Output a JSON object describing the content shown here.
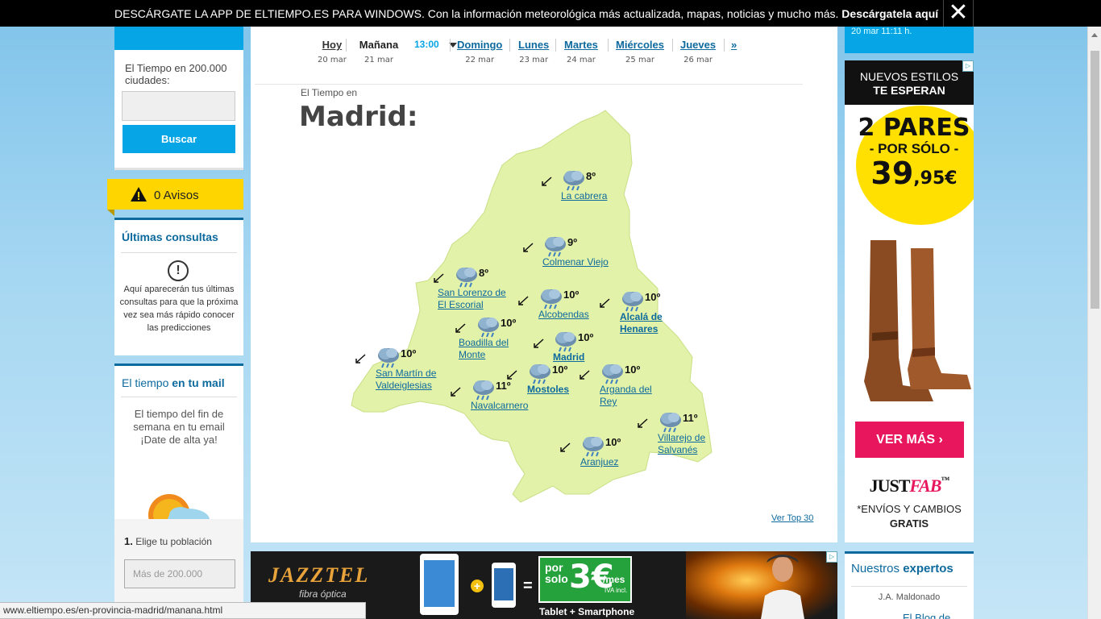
{
  "banner": {
    "text": "DESCÁRGATE LA APP DE ELTIEMPO.ES PARA WINDOWS. Con la información meteorológica más actualizada, mapas, noticias y mucho más.",
    "link": "Descárgatela aquí",
    "close_icon": "close-icon"
  },
  "search": {
    "label": "El Tiempo en 200.000 ciudades:",
    "value": "",
    "button": "Buscar"
  },
  "avisos": {
    "label": "0 Avisos",
    "icon": "warning-icon"
  },
  "consultas": {
    "title": "Últimas consultas",
    "icon": "info-icon",
    "message": "Aquí aparecerán tus últimas consultas para que la próxima vez sea más rápido conocer las predicciones"
  },
  "mail": {
    "title_pre": "El tiempo",
    "title_bold": "en tu mail",
    "message_1": "El tiempo del fin de semana en tu email",
    "message_2": "¡Date de alta ya!",
    "step_num": "1.",
    "step_label": "Elige tu población",
    "step_placeholder": "Más de 200.000"
  },
  "days": [
    {
      "name": "Hoy",
      "date": "20 mar"
    },
    {
      "name": "Mañana",
      "date": "21 mar",
      "time": "13:00",
      "current": true
    },
    {
      "name": "Domingo",
      "date": "22 mar"
    },
    {
      "name": "Lunes",
      "date": "23 mar"
    },
    {
      "name": "Martes",
      "date": "24 mar"
    },
    {
      "name": "Miércoles",
      "date": "25 mar"
    },
    {
      "name": "Jueves",
      "date": "26 mar"
    },
    {
      "name": "»"
    }
  ],
  "main": {
    "subtitle": "El Tiempo en",
    "title": "Madrid:",
    "ver_top": "Ver Top 30",
    "map_color": "#e2f2a8"
  },
  "locations": [
    {
      "name1": "La cabrera",
      "name2": "",
      "temp": "8º"
    },
    {
      "name1": "Colmenar Viejo",
      "name2": "",
      "temp": "9º"
    },
    {
      "name1": "San Lorenzo de",
      "name2": "El Escorial",
      "temp": "8º"
    },
    {
      "name1": "Alcobendas",
      "name2": "",
      "temp": "10º"
    },
    {
      "name1": "Alcalá de",
      "name2": "Henares",
      "temp": "10º",
      "bold": true
    },
    {
      "name1": "Boadilla del",
      "name2": "Monte",
      "temp": "10º"
    },
    {
      "name1": "Madrid",
      "name2": "",
      "temp": "10º",
      "bold": true
    },
    {
      "name1": "San Martín de",
      "name2": "Valdeiglesias",
      "temp": "10º"
    },
    {
      "name1": "Mostoles",
      "name2": "",
      "temp": "10º",
      "bold": true
    },
    {
      "name1": "Arganda del",
      "name2": "Rey",
      "temp": "10º"
    },
    {
      "name1": "Navalcarnero",
      "name2": "",
      "temp": "11º"
    },
    {
      "name1": "Villarejo de",
      "name2": "Salvanés",
      "temp": "11º"
    },
    {
      "name1": "Aranjuez",
      "name2": "",
      "temp": "10º"
    }
  ],
  "right": {
    "top_text": "20 mar 11:11 h.",
    "ad_head_1": "NUEVOS ESTILOS",
    "ad_head_2": "TE ESPERAN",
    "offer_1": "2 PARES",
    "offer_2": "- POR SÓLO -",
    "offer_3": "39",
    "offer_3b": ",95€",
    "ver_mas": "VER MÁS ›",
    "brand_1": "JUST",
    "brand_2": "FAB",
    "brand_tm": "™",
    "ship_1": "*ENVÍOS Y CAMBIOS",
    "ship_2": "GRATIS",
    "expertos_pre": "Nuestros",
    "expertos_bold": "expertos",
    "expert_name": "J.A. Maldonado",
    "expert_blog": "El Blog de"
  },
  "bottom_ad": {
    "brand": "JAZZTEL",
    "sub": "fibra óptica",
    "plus": "+",
    "eq": "=",
    "por_solo": "por solo",
    "price": "3€",
    "per": "/mes",
    "iva": "IVA incl.",
    "caption": "Tablet + Smartphone"
  },
  "status_bar": "www.eltiempo.es/en-provincia-madrid/manana.html"
}
